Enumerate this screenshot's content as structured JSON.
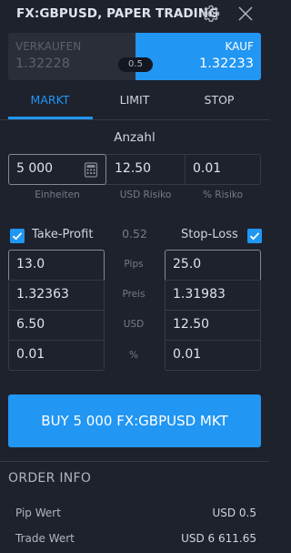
{
  "header": {
    "title": "FX:GBPUSD, PAPER TRADING",
    "icons": [
      "gear-icon",
      "close-icon"
    ]
  },
  "quote": {
    "sell_label": "VERKAUFEN",
    "sell_price": "1.32228",
    "buy_label": "KAUF",
    "buy_price": "1.32233",
    "spread": "0.5"
  },
  "tabs": [
    {
      "label": "MARKT",
      "active": true
    },
    {
      "label": "LIMIT",
      "active": false
    },
    {
      "label": "STOP",
      "active": false
    }
  ],
  "quantity": {
    "title": "Anzahl",
    "units_value": "5 000",
    "units_label": "Einheiten",
    "usd_risk_value": "12.50",
    "usd_risk_label": "USD Risiko",
    "pct_risk_value": "0.01",
    "pct_risk_label": "% Risiko"
  },
  "take_profit": {
    "label": "Take-Profit",
    "checked": true,
    "pips": "13.0",
    "price": "1.32363",
    "usd": "6.50",
    "pct": "0.01"
  },
  "stop_loss": {
    "label": "Stop-Loss",
    "checked": true,
    "pips": "25.0",
    "price": "1.31983",
    "usd": "12.50",
    "pct": "0.01"
  },
  "ratio": "0.52",
  "row_labels": {
    "pips": "Pips",
    "price": "Preis",
    "usd": "USD",
    "pct": "%"
  },
  "order_button": "BUY 5 000 FX:GBPUSD MKT",
  "order_info": {
    "title": "ORDER INFO",
    "rows": [
      {
        "label": "Pip Wert",
        "value": "USD 0.5"
      },
      {
        "label": "Trade Wert",
        "value": "USD 6 611.65"
      }
    ]
  },
  "colors": {
    "background": "#1e222d",
    "accent": "#2196f3",
    "border": "#363a45",
    "muted": "#787b86"
  }
}
